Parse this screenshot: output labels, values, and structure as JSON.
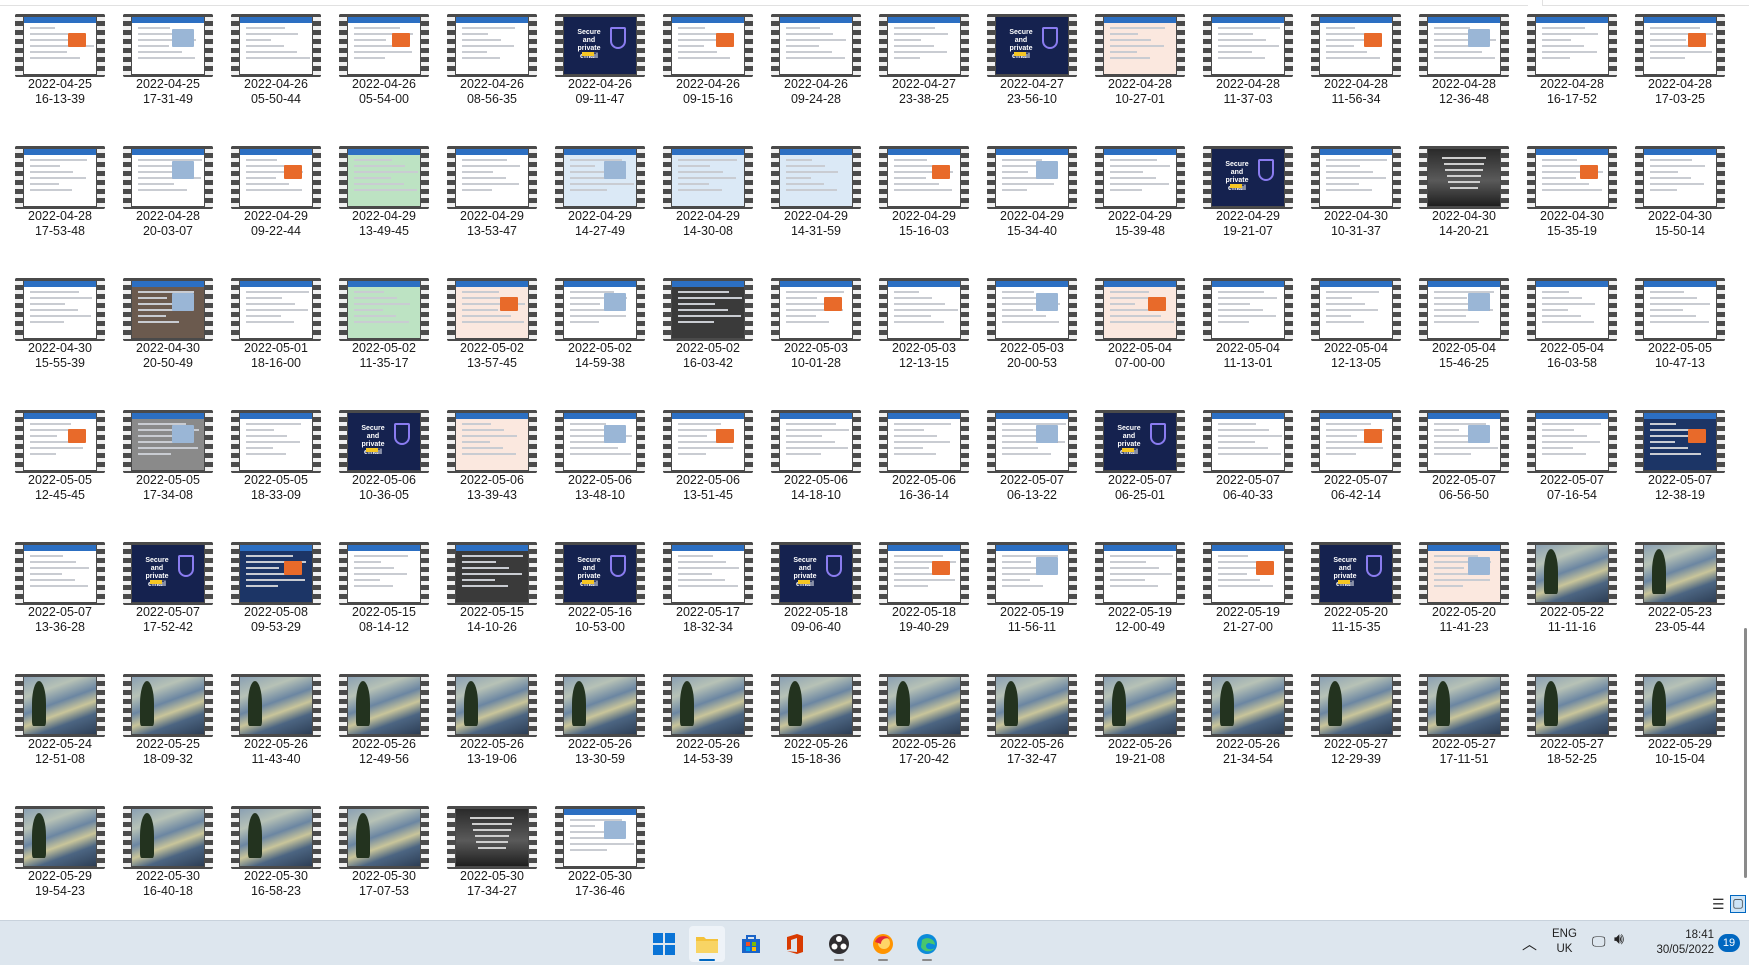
{
  "videos": [
    {
      "date": "2022-04-25",
      "time": "16-13-39",
      "style": "web"
    },
    {
      "date": "2022-04-25",
      "time": "17-31-49",
      "style": "web"
    },
    {
      "date": "2022-04-26",
      "time": "05-50-44",
      "style": "web"
    },
    {
      "date": "2022-04-26",
      "time": "05-54-00",
      "style": "web"
    },
    {
      "date": "2022-04-26",
      "time": "08-56-35",
      "style": "web"
    },
    {
      "date": "2022-04-26",
      "time": "09-11-47",
      "style": "email"
    },
    {
      "date": "2022-04-26",
      "time": "09-15-16",
      "style": "web"
    },
    {
      "date": "2022-04-26",
      "time": "09-24-28",
      "style": "web"
    },
    {
      "date": "2022-04-27",
      "time": "23-38-25",
      "style": "web"
    },
    {
      "date": "2022-04-27",
      "time": "23-56-10",
      "style": "email"
    },
    {
      "date": "2022-04-28",
      "time": "10-27-01",
      "style": "beige"
    },
    {
      "date": "2022-04-28",
      "time": "11-37-03",
      "style": "web"
    },
    {
      "date": "2022-04-28",
      "time": "11-56-34",
      "style": "web"
    },
    {
      "date": "2022-04-28",
      "time": "12-36-48",
      "style": "web"
    },
    {
      "date": "2022-04-28",
      "time": "16-17-52",
      "style": "web"
    },
    {
      "date": "2022-04-28",
      "time": "17-03-25",
      "style": "web"
    },
    {
      "date": "2022-04-28",
      "time": "17-53-48",
      "style": "web"
    },
    {
      "date": "2022-04-28",
      "time": "20-03-07",
      "style": "web"
    },
    {
      "date": "2022-04-29",
      "time": "09-22-44",
      "style": "web"
    },
    {
      "date": "2022-04-29",
      "time": "13-49-45",
      "style": "map"
    },
    {
      "date": "2022-04-29",
      "time": "13-53-47",
      "style": "web"
    },
    {
      "date": "2022-04-29",
      "time": "14-27-49",
      "style": "blue"
    },
    {
      "date": "2022-04-29",
      "time": "14-30-08",
      "style": "blue"
    },
    {
      "date": "2022-04-29",
      "time": "14-31-59",
      "style": "blue"
    },
    {
      "date": "2022-04-29",
      "time": "15-16-03",
      "style": "web"
    },
    {
      "date": "2022-04-29",
      "time": "15-34-40",
      "style": "web"
    },
    {
      "date": "2022-04-29",
      "time": "15-39-48",
      "style": "web"
    },
    {
      "date": "2022-04-29",
      "time": "19-21-07",
      "style": "email"
    },
    {
      "date": "2022-04-30",
      "time": "10-31-37",
      "style": "web"
    },
    {
      "date": "2022-04-30",
      "time": "14-20-21",
      "style": "dark"
    },
    {
      "date": "2022-04-30",
      "time": "15-35-19",
      "style": "web"
    },
    {
      "date": "2022-04-30",
      "time": "15-50-14",
      "style": "web"
    },
    {
      "date": "2022-04-30",
      "time": "15-55-39",
      "style": "web"
    },
    {
      "date": "2022-04-30",
      "time": "20-50-49",
      "style": "brown"
    },
    {
      "date": "2022-05-01",
      "time": "18-16-00",
      "style": "web"
    },
    {
      "date": "2022-05-02",
      "time": "11-35-17",
      "style": "map"
    },
    {
      "date": "2022-05-02",
      "time": "13-57-45",
      "style": "beige"
    },
    {
      "date": "2022-05-02",
      "time": "14-59-38",
      "style": "web"
    },
    {
      "date": "2022-05-02",
      "time": "16-03-42",
      "style": "black"
    },
    {
      "date": "2022-05-03",
      "time": "10-01-28",
      "style": "web"
    },
    {
      "date": "2022-05-03",
      "time": "12-13-15",
      "style": "web"
    },
    {
      "date": "2022-05-03",
      "time": "20-00-53",
      "style": "web"
    },
    {
      "date": "2022-05-04",
      "time": "07-00-00",
      "style": "beige"
    },
    {
      "date": "2022-05-04",
      "time": "11-13-01",
      "style": "web"
    },
    {
      "date": "2022-05-04",
      "time": "12-13-05",
      "style": "web"
    },
    {
      "date": "2022-05-04",
      "time": "15-46-25",
      "style": "web"
    },
    {
      "date": "2022-05-04",
      "time": "16-03-58",
      "style": "web"
    },
    {
      "date": "2022-05-05",
      "time": "10-47-13",
      "style": "web"
    },
    {
      "date": "2022-05-05",
      "time": "12-45-45",
      "style": "web"
    },
    {
      "date": "2022-05-05",
      "time": "17-34-08",
      "style": "gray"
    },
    {
      "date": "2022-05-05",
      "time": "18-33-09",
      "style": "web"
    },
    {
      "date": "2022-05-06",
      "time": "10-36-05",
      "style": "email"
    },
    {
      "date": "2022-05-06",
      "time": "13-39-43",
      "style": "beige"
    },
    {
      "date": "2022-05-06",
      "time": "13-48-10",
      "style": "web"
    },
    {
      "date": "2022-05-06",
      "time": "13-51-45",
      "style": "web"
    },
    {
      "date": "2022-05-06",
      "time": "14-18-10",
      "style": "web"
    },
    {
      "date": "2022-05-06",
      "time": "16-36-14",
      "style": "web"
    },
    {
      "date": "2022-05-07",
      "time": "06-13-22",
      "style": "web"
    },
    {
      "date": "2022-05-07",
      "time": "06-25-01",
      "style": "email"
    },
    {
      "date": "2022-05-07",
      "time": "06-40-33",
      "style": "web"
    },
    {
      "date": "2022-05-07",
      "time": "06-42-14",
      "style": "web"
    },
    {
      "date": "2022-05-07",
      "time": "06-56-50",
      "style": "web"
    },
    {
      "date": "2022-05-07",
      "time": "07-16-54",
      "style": "web"
    },
    {
      "date": "2022-05-07",
      "time": "12-38-19",
      "style": "navy"
    },
    {
      "date": "2022-05-07",
      "time": "13-36-28",
      "style": "web"
    },
    {
      "date": "2022-05-07",
      "time": "17-52-42",
      "style": "email"
    },
    {
      "date": "2022-05-08",
      "time": "09-53-29",
      "style": "navy"
    },
    {
      "date": "2022-05-15",
      "time": "08-14-12",
      "style": "web"
    },
    {
      "date": "2022-05-15",
      "time": "14-10-26",
      "style": "black"
    },
    {
      "date": "2022-05-16",
      "time": "10-53-00",
      "style": "email"
    },
    {
      "date": "2022-05-17",
      "time": "18-32-34",
      "style": "web"
    },
    {
      "date": "2022-05-18",
      "time": "09-06-40",
      "style": "email"
    },
    {
      "date": "2022-05-18",
      "time": "19-40-29",
      "style": "web"
    },
    {
      "date": "2022-05-19",
      "time": "11-56-11",
      "style": "web"
    },
    {
      "date": "2022-05-19",
      "time": "12-00-49",
      "style": "web"
    },
    {
      "date": "2022-05-19",
      "time": "21-27-00",
      "style": "web"
    },
    {
      "date": "2022-05-20",
      "time": "11-15-35",
      "style": "email"
    },
    {
      "date": "2022-05-20",
      "time": "11-41-23",
      "style": "beige"
    },
    {
      "date": "2022-05-22",
      "time": "11-11-16",
      "style": "painting"
    },
    {
      "date": "2022-05-23",
      "time": "23-05-44",
      "style": "painting"
    },
    {
      "date": "2022-05-24",
      "time": "12-51-08",
      "style": "painting"
    },
    {
      "date": "2022-05-25",
      "time": "18-09-32",
      "style": "painting"
    },
    {
      "date": "2022-05-26",
      "time": "11-43-40",
      "style": "painting"
    },
    {
      "date": "2022-05-26",
      "time": "12-49-56",
      "style": "painting"
    },
    {
      "date": "2022-05-26",
      "time": "13-19-06",
      "style": "painting"
    },
    {
      "date": "2022-05-26",
      "time": "13-30-59",
      "style": "painting"
    },
    {
      "date": "2022-05-26",
      "time": "14-53-39",
      "style": "painting"
    },
    {
      "date": "2022-05-26",
      "time": "15-18-36",
      "style": "painting"
    },
    {
      "date": "2022-05-26",
      "time": "17-20-42",
      "style": "painting"
    },
    {
      "date": "2022-05-26",
      "time": "17-32-47",
      "style": "painting"
    },
    {
      "date": "2022-05-26",
      "time": "19-21-08",
      "style": "painting"
    },
    {
      "date": "2022-05-26",
      "time": "21-34-54",
      "style": "painting"
    },
    {
      "date": "2022-05-27",
      "time": "12-29-39",
      "style": "painting"
    },
    {
      "date": "2022-05-27",
      "time": "17-11-51",
      "style": "painting"
    },
    {
      "date": "2022-05-27",
      "time": "18-52-25",
      "style": "painting"
    },
    {
      "date": "2022-05-29",
      "time": "10-15-04",
      "style": "painting"
    },
    {
      "date": "2022-05-29",
      "time": "19-54-23",
      "style": "painting"
    },
    {
      "date": "2022-05-30",
      "time": "16-40-18",
      "style": "painting"
    },
    {
      "date": "2022-05-30",
      "time": "16-58-23",
      "style": "painting"
    },
    {
      "date": "2022-05-30",
      "time": "17-07-53",
      "style": "painting"
    },
    {
      "date": "2022-05-30",
      "time": "17-34-27",
      "style": "dark"
    },
    {
      "date": "2022-05-30",
      "time": "17-36-46",
      "style": "web"
    }
  ],
  "thumbnail_text": {
    "email_headline": "Secure and private email"
  },
  "taskbar": {
    "apps": [
      {
        "name": "start",
        "icon": "windows-start-icon",
        "active": false,
        "running": false
      },
      {
        "name": "file-explorer",
        "icon": "folder-icon",
        "active": true,
        "running": true
      },
      {
        "name": "microsoft-store",
        "icon": "store-icon",
        "active": false,
        "running": false
      },
      {
        "name": "office",
        "icon": "office-icon",
        "active": false,
        "running": false
      },
      {
        "name": "obs",
        "icon": "record-icon",
        "active": false,
        "running": true
      },
      {
        "name": "firefox",
        "icon": "firefox-icon",
        "active": false,
        "running": true
      },
      {
        "name": "edge",
        "icon": "edge-icon",
        "active": false,
        "running": true
      }
    ],
    "tray": {
      "lang_line1": "ENG",
      "lang_line2": "UK",
      "time": "18:41",
      "date": "30/05/2022",
      "notifications": "19"
    }
  },
  "colors": {
    "accent": "#0067c0",
    "taskbar_bg": "#dde6ee",
    "film": "#4a4a4a"
  }
}
